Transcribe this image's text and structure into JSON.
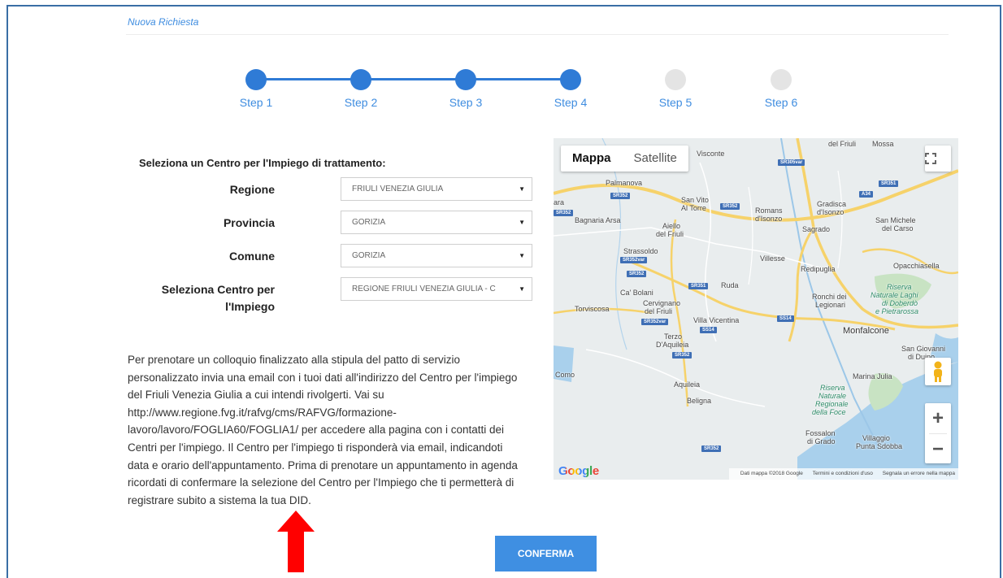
{
  "breadcrumb": "Nuova Richiesta",
  "steps": [
    {
      "label": "Step 1",
      "state": "done"
    },
    {
      "label": "Step 2",
      "state": "done"
    },
    {
      "label": "Step 3",
      "state": "done"
    },
    {
      "label": "Step 4",
      "state": "done"
    },
    {
      "label": "Step 5",
      "state": "todo"
    },
    {
      "label": "Step 6",
      "state": "todo"
    }
  ],
  "form": {
    "title": "Seleziona un Centro per l'Impiego di trattamento:",
    "regione_label": "Regione",
    "regione_value": "FRIULI VENEZIA GIULIA",
    "provincia_label": "Provincia",
    "provincia_value": "GORIZIA",
    "comune_label": "Comune",
    "comune_value": "GORIZIA",
    "centro_label_line1": "Seleziona Centro per",
    "centro_label_line2": "l'Impiego",
    "centro_value": "REGIONE FRIULI VENEZIA GIULIA - C"
  },
  "info_text": "Per prenotare un colloquio finalizzato alla stipula del patto di servizio personalizzato invia una email con i tuoi dati all'indirizzo del Centro per l'impiego del Friuli Venezia Giulia a cui intendi rivolgerti. Vai su http://www.regione.fvg.it/rafvg/cms/RAFVG/formazione-lavoro/lavoro/FOGLIA60/FOGLIA1/ per accedere alla pagina con i contatti dei Centri per l'impiego. Il Centro per l'impiego ti risponderà via email, indicandoti data e orario dell'appuntamento. Prima di prenotare un appuntamento in agenda ricordati di confermare la selezione del Centro per l'Impiego che ti permetterà di registrare subito a sistema la tua DID.",
  "map": {
    "tab_map": "Mappa",
    "tab_satellite": "Satellite",
    "fullscreen_icon": "fullscreen-icon",
    "pegman_icon": "pegman-icon",
    "zoom_in": "+",
    "zoom_out": "−",
    "logo": "Google",
    "attribution_data": "Dati mappa ©2018 Google",
    "attribution_terms": "Termini e condizioni d'uso",
    "attribution_report": "Segnala un errore nella mappa",
    "places": {
      "palmanova": "Palmanova",
      "sanvito": "San Vito",
      "altorre": "Al Torre",
      "visconte": "Visconte",
      "romans": "Romans",
      "disonzo": "d'Isonzo",
      "gradisca": "Gradisca",
      "gradisca2": "d'Isonzo",
      "sanmichele": "San Michele",
      "delcarso": "del Carso",
      "bagnaria": "Bagnaria Arsa",
      "aiello": "Aiello",
      "delfriuli": "del Friuli",
      "sagrado": "Sagrado",
      "strassoldo": "Strassoldo",
      "villesse": "Villesse",
      "redipuglia": "Redipuglia",
      "opacchiasella": "Opacchiasella",
      "cabolani": "Ca' Bolani",
      "ruda": "Ruda",
      "ronchi": "Ronchi dei",
      "legionari": "Legionari",
      "riserva1": "Riserva",
      "riserva2": "Naturale Laghi",
      "riserva3": "di Doberdò",
      "riserva4": "e Pietrarossa",
      "torviscosa": "Torviscosa",
      "cervignano": "Cervignano",
      "cervignano2": "del Friuli",
      "villavicentina": "Villa Vicentina",
      "monfalcone": "Monfalcone",
      "terzo": "Terzo",
      "daquileia": "D'Aquileia",
      "sangiovanni": "San Giovanni",
      "sangiovanni2": "di Duino",
      "aquileia": "Aquileia",
      "marinajulia": "Marina Julia",
      "belligna": "Beligna",
      "foce1": "Riserva",
      "foce2": "Naturale",
      "foce3": "Regionale",
      "foce4": "della Foce",
      "fossalon": "Fossalon",
      "digrado": "di Grado",
      "villaggio": "Villaggio",
      "puntasdobba": "Punta Sdobba",
      "delfriuli_top": "del Friuli",
      "mossa": "Mossa",
      "ara": "ara",
      "como": "Como"
    },
    "shields": [
      "SR352",
      "SR352",
      "SR352var",
      "SR352",
      "SR351",
      "SR352var",
      "SS14",
      "SS14",
      "SR352",
      "SR352",
      "SR305var",
      "SR351",
      "A34"
    ]
  },
  "confirm_label": "CONFERMA",
  "colors": {
    "accent": "#2f7bd6",
    "button": "#3f8fe2",
    "arrow": "#ff0000"
  }
}
